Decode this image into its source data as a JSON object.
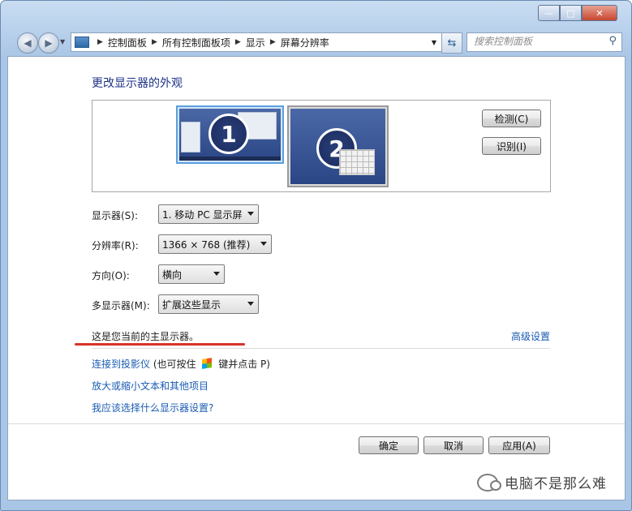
{
  "window": {
    "controls": {
      "minimize": "—",
      "maximize": "□",
      "close": "✕"
    }
  },
  "navbar": {
    "back_icon": "back-arrow-icon",
    "forward_icon": "forward-arrow-icon",
    "breadcrumbs": [
      "控制面板",
      "所有控制面板项",
      "显示",
      "屏幕分辨率"
    ],
    "search_placeholder": "搜索控制面板"
  },
  "page": {
    "title": "更改显示器的外观",
    "monitors": [
      {
        "number": "1",
        "selected": true
      },
      {
        "number": "2",
        "selected": false
      }
    ],
    "detect_button": "检测(C)",
    "identify_button": "识别(I)",
    "fields": {
      "display_label": "显示器(S):",
      "display_value": "1. 移动 PC 显示屏",
      "resolution_label": "分辨率(R):",
      "resolution_value": "1366 × 768 (推荐)",
      "orientation_label": "方向(O):",
      "orientation_value": "横向",
      "multi_label": "多显示器(M):",
      "multi_value": "扩展这些显示"
    },
    "status_text": "这是您当前的主显示器。",
    "advanced_link": "高级设置",
    "links": {
      "projector": "连接到投影仪",
      "projector_hint_pre": "(也可按住",
      "projector_hint_post": "键并点击 P)",
      "text_size": "放大或缩小文本和其他项目",
      "which_settings": "我应该选择什么显示器设置?"
    },
    "buttons": {
      "ok": "确定",
      "cancel": "取消",
      "apply": "应用(A)"
    }
  },
  "watermark": {
    "text": "电脑不是那么难"
  },
  "colors": {
    "title": "#1e3287",
    "link": "#1a5bb3",
    "annotation_line": "#d8322a",
    "selected_border": "#5aa0e0"
  }
}
